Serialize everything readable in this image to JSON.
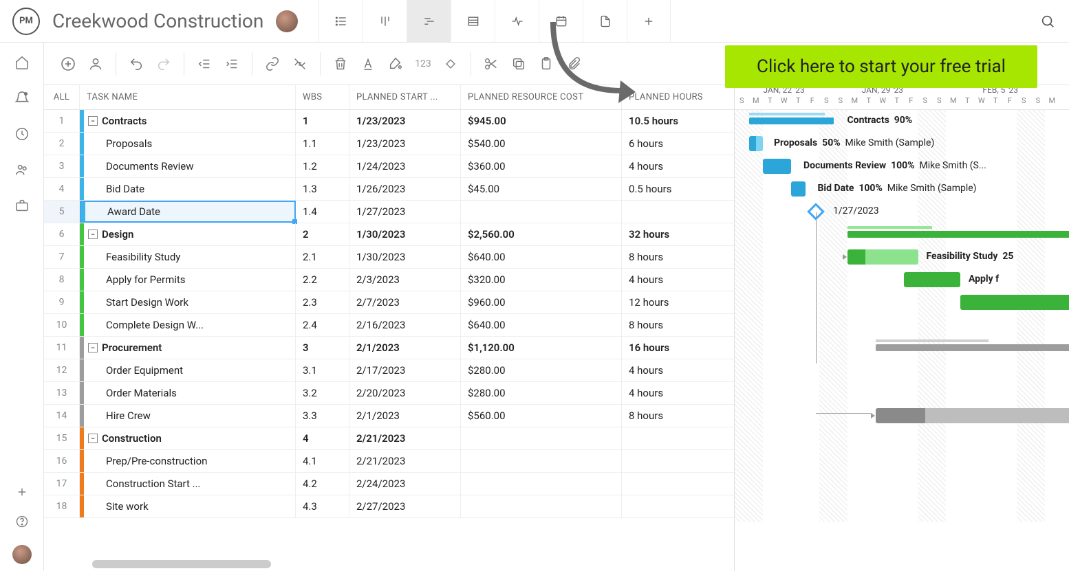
{
  "header": {
    "logo_text": "PM",
    "project_title": "Creekwood Construction"
  },
  "cta": {
    "text": "Click here to start your free trial"
  },
  "columns": {
    "all": "ALL",
    "task_name": "TASK NAME",
    "wbs": "WBS",
    "planned_start": "PLANNED START ...",
    "planned_cost": "PLANNED RESOURCE COST",
    "planned_hours": "PLANNED HOURS"
  },
  "timeline": {
    "weeks": [
      "JAN, 22 '23",
      "JAN, 29 '23",
      "FEB, 5 '23"
    ],
    "days": [
      "S",
      "M",
      "T",
      "W",
      "T",
      "F",
      "S",
      "S",
      "M",
      "T",
      "W",
      "T",
      "F",
      "S",
      "S",
      "M",
      "T",
      "W",
      "T",
      "F",
      "S",
      "S",
      "M"
    ]
  },
  "colors": {
    "contracts": "#3bb5e8",
    "design": "#43c743",
    "procurement": "#9d9d9d",
    "construction": "#f07b1a"
  },
  "tasks": [
    {
      "n": 1,
      "name": "Contracts",
      "wbs": "1",
      "start": "1/23/2023",
      "cost": "$945.00",
      "hours": "10.5 hours",
      "parent": true,
      "color": "contracts",
      "indent": 0
    },
    {
      "n": 2,
      "name": "Proposals",
      "wbs": "1.1",
      "start": "1/23/2023",
      "cost": "$540.00",
      "hours": "6 hours",
      "color": "contracts",
      "indent": 1
    },
    {
      "n": 3,
      "name": "Documents Review",
      "wbs": "1.2",
      "start": "1/24/2023",
      "cost": "$360.00",
      "hours": "4 hours",
      "color": "contracts",
      "indent": 1
    },
    {
      "n": 4,
      "name": "Bid Date",
      "wbs": "1.3",
      "start": "1/26/2023",
      "cost": "$45.00",
      "hours": "0.5 hours",
      "color": "contracts",
      "indent": 1
    },
    {
      "n": 5,
      "name": "Award Date",
      "wbs": "1.4",
      "start": "1/27/2023",
      "cost": "",
      "hours": "",
      "color": "contracts",
      "indent": 1,
      "selected": true
    },
    {
      "n": 6,
      "name": "Design",
      "wbs": "2",
      "start": "1/30/2023",
      "cost": "$2,560.00",
      "hours": "32 hours",
      "parent": true,
      "color": "design",
      "indent": 0
    },
    {
      "n": 7,
      "name": "Feasibility Study",
      "wbs": "2.1",
      "start": "1/30/2023",
      "cost": "$640.00",
      "hours": "8 hours",
      "color": "design",
      "indent": 1
    },
    {
      "n": 8,
      "name": "Apply for Permits",
      "wbs": "2.2",
      "start": "2/3/2023",
      "cost": "$320.00",
      "hours": "4 hours",
      "color": "design",
      "indent": 1
    },
    {
      "n": 9,
      "name": "Start Design Work",
      "wbs": "2.3",
      "start": "2/7/2023",
      "cost": "$960.00",
      "hours": "12 hours",
      "color": "design",
      "indent": 1
    },
    {
      "n": 10,
      "name": "Complete Design W...",
      "wbs": "2.4",
      "start": "2/16/2023",
      "cost": "$640.00",
      "hours": "8 hours",
      "color": "design",
      "indent": 1
    },
    {
      "n": 11,
      "name": "Procurement",
      "wbs": "3",
      "start": "2/1/2023",
      "cost": "$1,120.00",
      "hours": "16 hours",
      "parent": true,
      "color": "procurement",
      "indent": 0
    },
    {
      "n": 12,
      "name": "Order Equipment",
      "wbs": "3.1",
      "start": "2/17/2023",
      "cost": "$280.00",
      "hours": "4 hours",
      "color": "procurement",
      "indent": 1
    },
    {
      "n": 13,
      "name": "Order Materials",
      "wbs": "3.2",
      "start": "2/20/2023",
      "cost": "$280.00",
      "hours": "4 hours",
      "color": "procurement",
      "indent": 1
    },
    {
      "n": 14,
      "name": "Hire Crew",
      "wbs": "3.3",
      "start": "2/1/2023",
      "cost": "$560.00",
      "hours": "8 hours",
      "color": "procurement",
      "indent": 1
    },
    {
      "n": 15,
      "name": "Construction",
      "wbs": "4",
      "start": "2/21/2023",
      "cost": "",
      "hours": "",
      "parent": true,
      "color": "construction",
      "indent": 0
    },
    {
      "n": 16,
      "name": "Prep/Pre-construction",
      "wbs": "4.1",
      "start": "2/21/2023",
      "cost": "",
      "hours": "",
      "color": "construction",
      "indent": 1
    },
    {
      "n": 17,
      "name": "Construction Start ...",
      "wbs": "4.2",
      "start": "2/24/2023",
      "cost": "",
      "hours": "",
      "color": "construction",
      "indent": 1
    },
    {
      "n": 18,
      "name": "Site work",
      "wbs": "4.3",
      "start": "2/27/2023",
      "cost": "",
      "hours": "",
      "color": "construction",
      "indent": 1
    }
  ],
  "gantt_labels": {
    "r0": {
      "bold": "Contracts",
      "pct": "90%"
    },
    "r1": {
      "bold": "Proposals",
      "pct": "50%",
      "assignee": "Mike Smith (Sample)"
    },
    "r2": {
      "bold": "Documents Review",
      "pct": "100%",
      "assignee": "Mike Smith (S..."
    },
    "r3": {
      "bold": "Bid Date",
      "pct": "100%",
      "assignee": "Mike Smith (Sample)"
    },
    "r4": {
      "text": "1/27/2023"
    },
    "r6": {
      "bold": "Feasibility Study",
      "pct": "25"
    },
    "r7": {
      "bold": "Apply f"
    }
  }
}
